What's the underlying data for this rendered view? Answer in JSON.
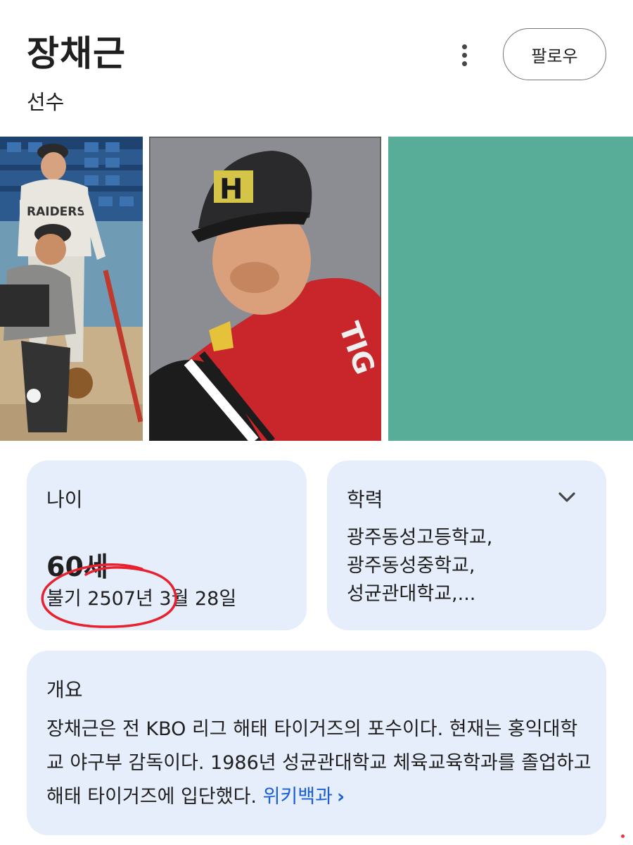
{
  "header": {
    "title": "장채근",
    "subtitle": "선수",
    "follow_label": "팔로우"
  },
  "gallery": {
    "photo2_cap_letter": "H",
    "photo1_jersey_text": "RAIDERS"
  },
  "age_card": {
    "label": "나이",
    "value": "60세",
    "birth_date": "불기 2507년 3월 28일"
  },
  "education_card": {
    "label": "학력",
    "items": [
      "광주동성고등학교,",
      "광주동성중학교,",
      "성균관대학교,..."
    ]
  },
  "overview_card": {
    "label": "개요",
    "text": "장채근은 전 KBO 리그 해태 타이거즈의 포수이다. 현재는 홍익대학교 야구부 감독이다. 1986년 성균관대학교 체육교육학과를 졸업하고 해태 타이거즈에 입단했다. ",
    "source_link": "위키백과",
    "source_arrow": "›"
  },
  "colors": {
    "card_bg": "#e6edfb",
    "photo3_bg": "#57ad98",
    "link": "#1a5fd6",
    "annotation": "#e8212e"
  },
  "icons": [
    "more-vert-icon",
    "chevron-down-icon",
    "chevron-right-icon"
  ]
}
